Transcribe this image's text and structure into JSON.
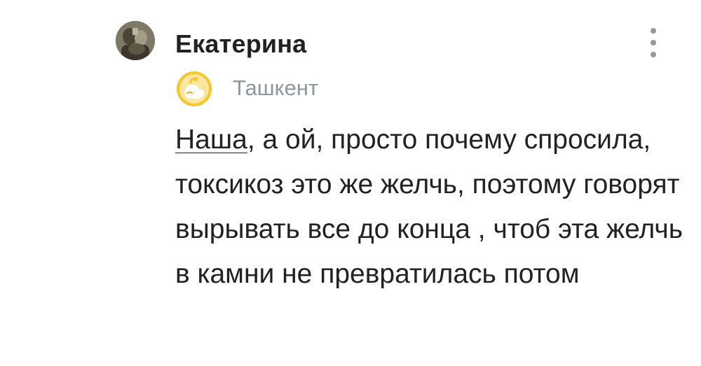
{
  "comment": {
    "author": "Екатерина",
    "location": "Ташкент",
    "mention": "Наша",
    "text_after_mention": ", а ой, просто почему спросила, токсикоз это же желчь, поэтому говорят вырывать все до конца , чтоб эта желчь в камни не превратилась потом",
    "icons": {
      "avatar": "user-avatar",
      "badge": "pregnancy-badge-icon",
      "menu": "more-vertical-icon"
    },
    "colors": {
      "text": "#222222",
      "muted": "#8e96a0",
      "badge": "#f5c518"
    }
  }
}
